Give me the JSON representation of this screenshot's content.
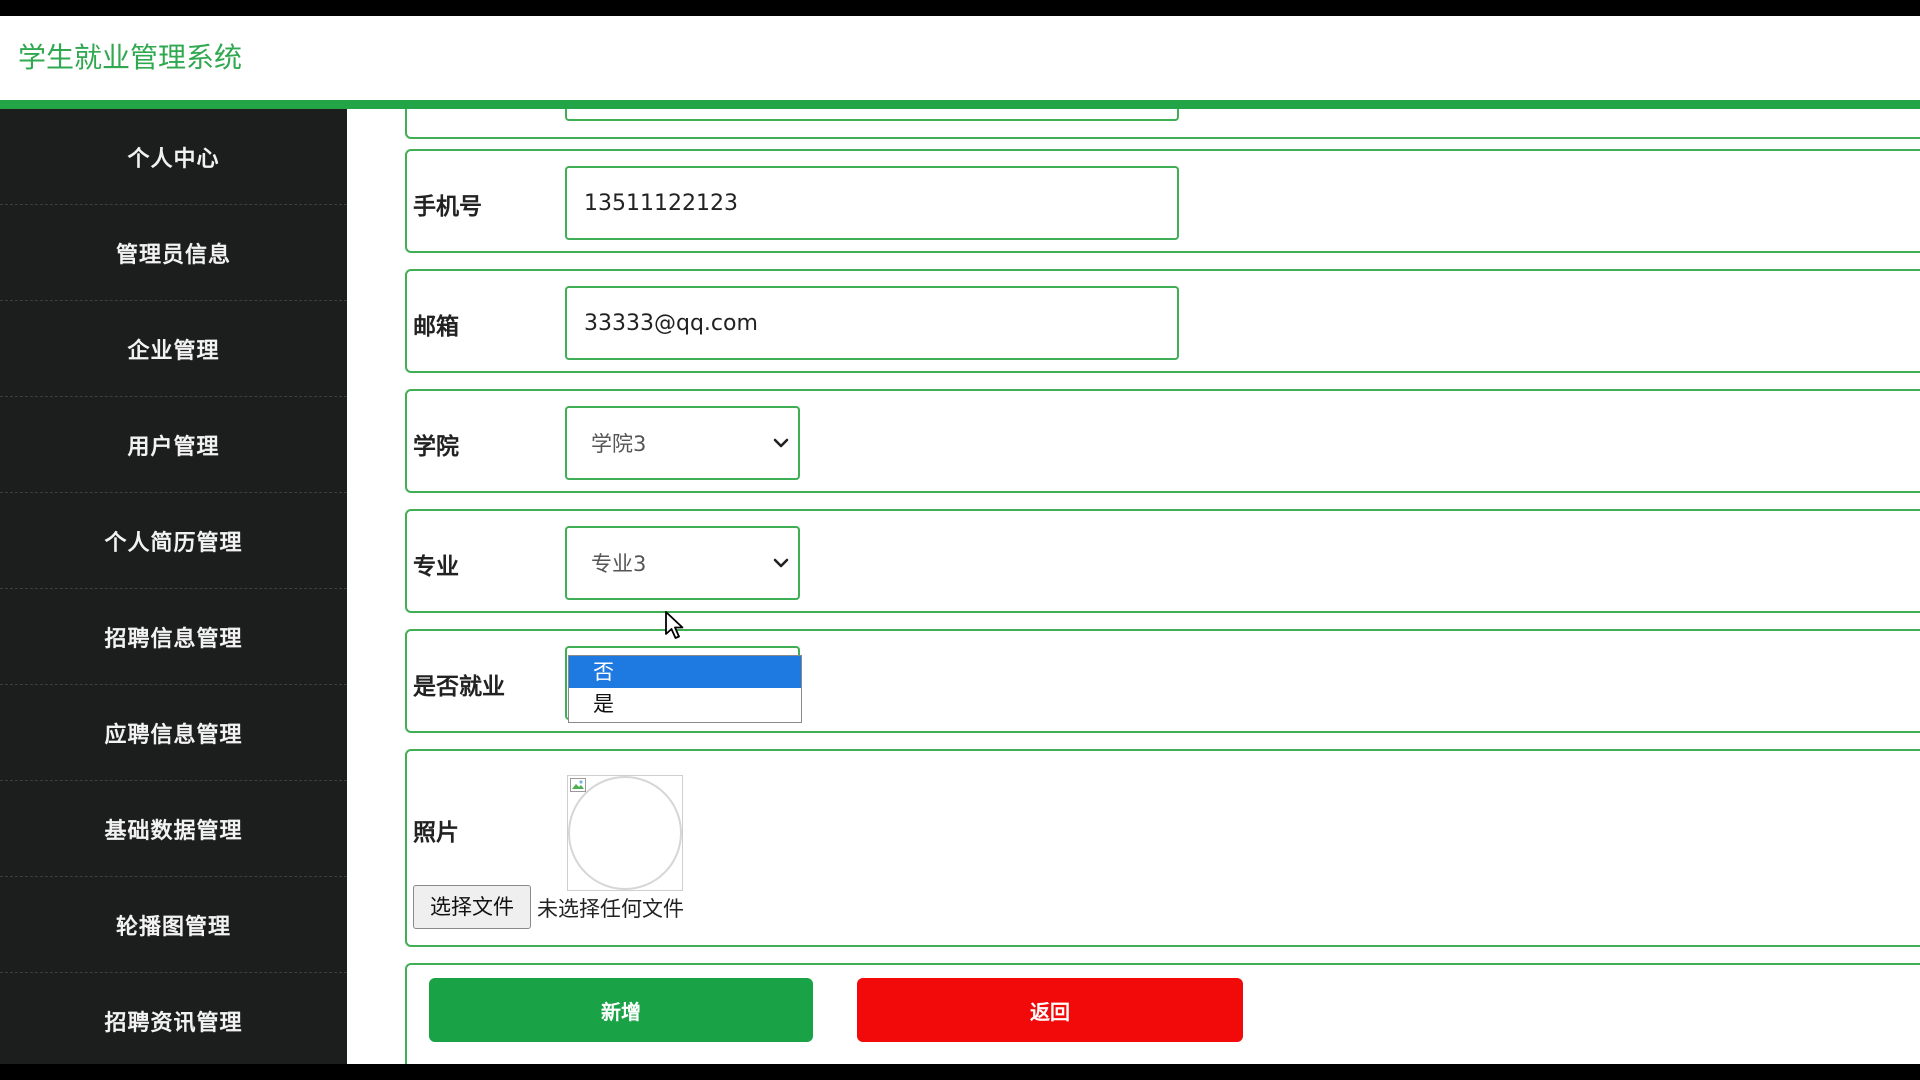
{
  "app": {
    "title": "学生就业管理系统"
  },
  "colors": {
    "accent_green": "#2fa84f",
    "header_bar_green": "#22a447",
    "sidebar_bg": "#1c1e1d",
    "add_button": "#19a346",
    "back_button": "#f20a0a",
    "dropdown_highlight": "#1e7ae0"
  },
  "sidebar": {
    "items": [
      {
        "label": "个人中心"
      },
      {
        "label": "管理员信息"
      },
      {
        "label": "企业管理"
      },
      {
        "label": "用户管理"
      },
      {
        "label": "个人简历管理"
      },
      {
        "label": "招聘信息管理"
      },
      {
        "label": "应聘信息管理"
      },
      {
        "label": "基础数据管理"
      },
      {
        "label": "轮播图管理"
      },
      {
        "label": "招聘资讯管理"
      }
    ]
  },
  "form": {
    "phone": {
      "label": "手机号",
      "value": "13511122123"
    },
    "email": {
      "label": "邮箱",
      "value": "33333@qq.com"
    },
    "college": {
      "label": "学院",
      "selected": "学院3"
    },
    "major": {
      "label": "专业",
      "selected": "专业3"
    },
    "employed": {
      "label": "是否就业",
      "selected": "否",
      "options": [
        "否",
        "是"
      ],
      "highlighted_index": 0
    },
    "photo": {
      "label": "照片",
      "file_button_label": "选择文件",
      "file_status": "未选择任何文件"
    },
    "buttons": {
      "add_label": "新增",
      "back_label": "返回"
    }
  }
}
